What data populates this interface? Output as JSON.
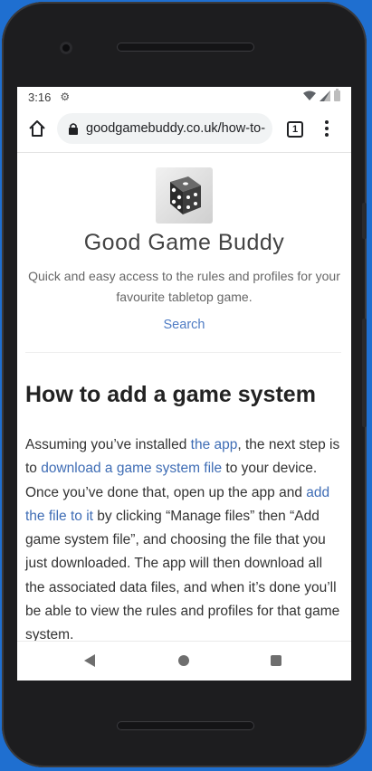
{
  "status_bar": {
    "time": "3:16"
  },
  "browser": {
    "url": "goodgamebuddy.co.uk/how-to-",
    "tab_count": "1"
  },
  "site": {
    "title": "Good Game Buddy",
    "tagline": "Quick and easy access to the rules and profiles for your favourite tabletop game.",
    "search_label": "Search"
  },
  "article": {
    "heading": "How to add a game system",
    "text_1": "Assuming you’ve installed ",
    "link_app": "the app",
    "text_2": ", the next step is to ",
    "link_download": "download a game system file",
    "text_3": " to your device. Once you’ve done that, open up the app and ",
    "link_add_file": "add the file to it",
    "text_4": " by clicking “Manage files” then “Add game system file”, and choosing the file that you just downloaded. The app will then download all the associated data files, and when it’s done you’ll be able to view the rules and profiles for that game system."
  },
  "icons": {
    "gear": "gear-icon",
    "wifi": "wifi-icon",
    "signal": "signal-icon",
    "battery": "battery-icon",
    "home": "home-icon",
    "lock": "lock-icon",
    "menu": "more-vert-icon",
    "back": "back-icon",
    "nav_home": "nav-home-icon",
    "recents": "recents-icon"
  },
  "colors": {
    "link": "#3f6db5",
    "search_link": "#4f7cc4",
    "desktop_bg": "#1f6fd0"
  }
}
